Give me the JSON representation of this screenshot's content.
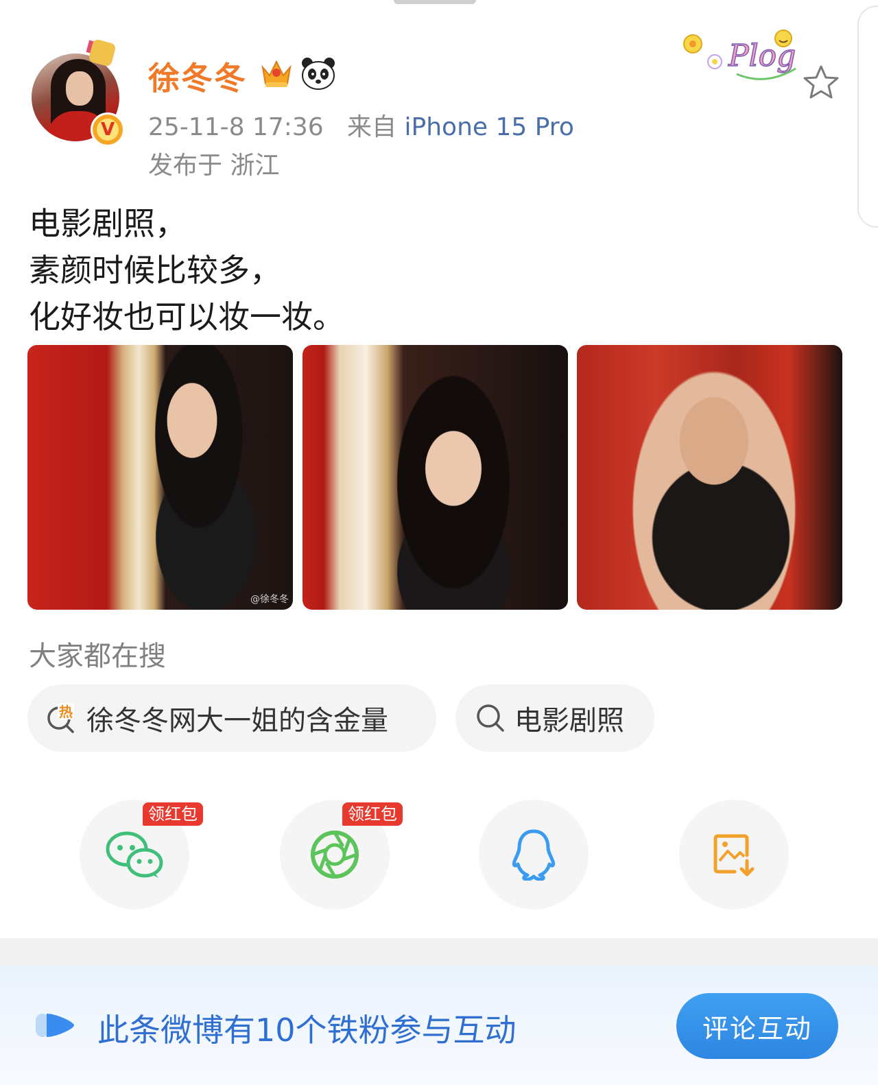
{
  "post": {
    "author": {
      "name": "徐冬冬",
      "badges": [
        "crown-icon",
        "panda-icon"
      ],
      "verified_icon": "verified-v-icon"
    },
    "timestamp": "25-11-8 17:36",
    "source_prefix": "来自",
    "source_device": "iPhone 15 Pro",
    "location": "发布于 浙江",
    "sticker_text": "Plog",
    "text_lines": [
      "电影剧照，",
      "素颜时候比较多，",
      "化好妆也可以妆一妆。"
    ],
    "photos": [
      {
        "watermark": "@徐冬冬"
      },
      {
        "watermark": ""
      },
      {
        "watermark": ""
      }
    ]
  },
  "trending": {
    "title": "大家都在搜",
    "chips": [
      {
        "label": "徐冬冬网大一姐的含金量",
        "icon": "hot-search-icon"
      },
      {
        "label": "电影剧照",
        "icon": "search-icon"
      }
    ]
  },
  "share": {
    "items": [
      {
        "icon": "wechat-icon",
        "badge": "领红包"
      },
      {
        "icon": "moments-icon",
        "badge": "领红包"
      },
      {
        "icon": "qq-icon",
        "badge": ""
      },
      {
        "icon": "save-image-icon",
        "badge": ""
      }
    ]
  },
  "banner": {
    "text": "此条微博有10个铁粉参与互动",
    "button": "评论互动"
  },
  "colors": {
    "username": "#ef7a2a",
    "accent_blue": "#2f6fd1",
    "promo_red": "#e8392f"
  }
}
